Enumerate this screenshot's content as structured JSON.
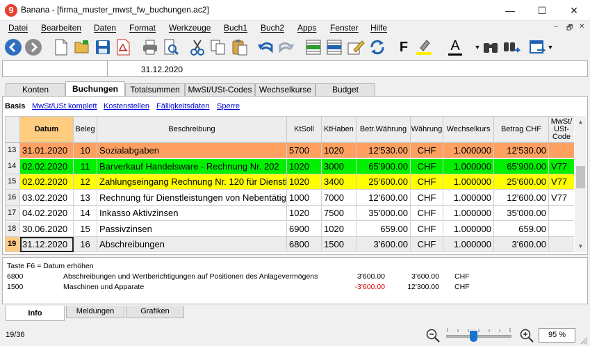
{
  "window": {
    "app_logo": "9",
    "title": "Banana - [firma_muster_mwst_fw_buchungen.ac2]",
    "minimize": "—",
    "maximize": "☐",
    "close": "✕"
  },
  "menu": {
    "items": [
      "Datei",
      "Bearbeiten",
      "Daten",
      "Format",
      "Werkzeuge",
      "Buch1",
      "Buch2",
      "Apps",
      "Fenster",
      "Hilfe"
    ],
    "mdi_minimize": "–",
    "mdi_restore": "🗗",
    "mdi_close": "✕"
  },
  "toolbar": {
    "icons": [
      "back-icon",
      "forward-icon",
      "new-file-icon",
      "open-folder-icon",
      "save-icon",
      "pdf-icon",
      "print-icon",
      "print-preview-icon",
      "cut-icon",
      "copy-icon",
      "paste-icon",
      "undo-icon",
      "redo-icon",
      "insert-rows-icon",
      "delete-rows-icon",
      "edit-icon",
      "recheck-icon",
      "bold-icon",
      "highlight-icon",
      "font-color-icon",
      "find-icon",
      "replace-icon",
      "window-icon"
    ],
    "bold_label": "F",
    "font_color_label": "A",
    "accent_color": "#1874cd"
  },
  "cell_bar": {
    "address": "",
    "value": "31.12.2020"
  },
  "tabs": [
    "Konten",
    "Buchungen",
    "Totalsummen",
    "MwSt/USt-Codes",
    "Wechselkurse",
    "Budget"
  ],
  "active_tab": "Buchungen",
  "views": [
    "Basis",
    "MwSt/USt komplett",
    "Kostenstellen",
    "Fälligkeitsdaten",
    "Sperre"
  ],
  "active_view": "Basis",
  "table": {
    "headers": [
      "Datum",
      "Beleg",
      "Beschreibung",
      "KtSoll",
      "KtHaben",
      "Betr.Währung",
      "Währung",
      "Wechselkurs",
      "Betrag CHF",
      "MwSt/ USt-Code"
    ],
    "rows": [
      {
        "nr": "13",
        "datum": "31.01.2020",
        "beleg": "10",
        "beschreibung": "Sozialabgaben",
        "ktsoll": "5700",
        "kthaben": "1020",
        "betrag_waehrung": "12'530.00",
        "waehrung": "CHF",
        "kurs": "1.000000",
        "betrag_chf": "12'530.00",
        "mwst": "",
        "color": "#ffa060"
      },
      {
        "nr": "14",
        "datum": "02.02.2020",
        "beleg": "11",
        "beschreibung": "Barverkauf Handelsware - Rechnung Nr. 202",
        "ktsoll": "1020",
        "kthaben": "3000",
        "betrag_waehrung": "65'900.00",
        "waehrung": "CHF",
        "kurs": "1.000000",
        "betrag_chf": "65'900.00",
        "mwst": "V77",
        "color": "#00f000"
      },
      {
        "nr": "15",
        "datum": "02.02.2020",
        "beleg": "12",
        "beschreibung": "Zahlungseingang Rechnung Nr. 120 für Dienstleistungen",
        "ktsoll": "1020",
        "kthaben": "3400",
        "betrag_waehrung": "25'600.00",
        "waehrung": "CHF",
        "kurs": "1.000000",
        "betrag_chf": "25'600.00",
        "mwst": "V77",
        "color": "#ffff00"
      },
      {
        "nr": "16",
        "datum": "03.02.2020",
        "beleg": "13",
        "beschreibung": "Rechnung für Dienstleistungen von Nebentätigkeit",
        "ktsoll": "1000",
        "kthaben": "7000",
        "betrag_waehrung": "12'600.00",
        "waehrung": "CHF",
        "kurs": "1.000000",
        "betrag_chf": "12'600.00",
        "mwst": "V77",
        "color": "#ffffff"
      },
      {
        "nr": "17",
        "datum": "04.02.2020",
        "beleg": "14",
        "beschreibung": "Inkasso Aktivzinsen",
        "ktsoll": "1020",
        "kthaben": "7500",
        "betrag_waehrung": "35'000.00",
        "waehrung": "CHF",
        "kurs": "1.000000",
        "betrag_chf": "35'000.00",
        "mwst": "",
        "color": "#ffffff"
      },
      {
        "nr": "18",
        "datum": "30.06.2020",
        "beleg": "15",
        "beschreibung": "Passivzinsen",
        "ktsoll": "6900",
        "kthaben": "1020",
        "betrag_waehrung": "659.00",
        "waehrung": "CHF",
        "kurs": "1.000000",
        "betrag_chf": "659.00",
        "mwst": "",
        "color": "#ffffff"
      },
      {
        "nr": "19",
        "datum": "31.12.2020",
        "beleg": "16",
        "beschreibung": "Abschreibungen",
        "ktsoll": "6800",
        "kthaben": "1500",
        "betrag_waehrung": "3'600.00",
        "waehrung": "CHF",
        "kurs": "1.000000",
        "betrag_chf": "3'600.00",
        "mwst": "",
        "color": "#ececec"
      }
    ],
    "selected_row": "19",
    "selected_column": "Datum"
  },
  "info": {
    "hint": "Taste F6 = Datum erhöhen",
    "lines": [
      {
        "account": "6800",
        "description": "Abschreibungen und Wertberichtigungen auf Positionen des Anlagevermögens",
        "amount": "3'600.00",
        "balance": "3'600.00",
        "currency": "CHF"
      },
      {
        "account": "1500",
        "description": "Maschinen und Apparate",
        "amount": "-3'600.00",
        "balance": "12'300.00",
        "currency": "CHF"
      }
    ]
  },
  "bottom_tabs": [
    "Info",
    "Meldungen",
    "Grafiken"
  ],
  "active_bottom_tab": "Info",
  "status": {
    "position": "19/36",
    "zoom": "95 %",
    "zoom_level": 0.42
  }
}
